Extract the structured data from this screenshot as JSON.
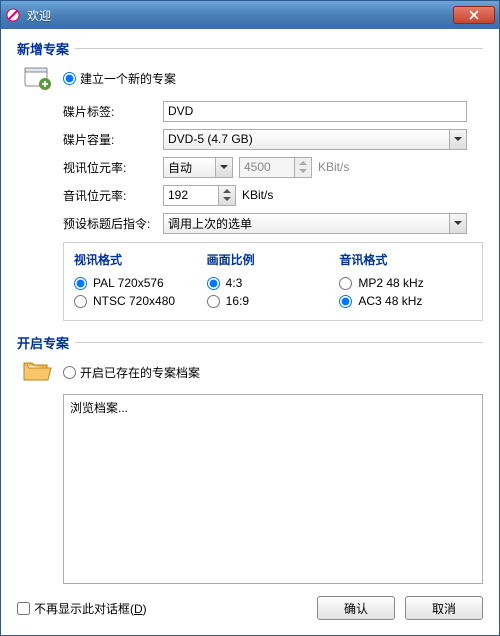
{
  "window": {
    "title": "欢迎"
  },
  "section_new": {
    "title": "新增专案",
    "create_option": "建立一个新的专案"
  },
  "form": {
    "disc_label_label": "碟片标签:",
    "disc_label_value": "DVD",
    "disc_capacity_label": "碟片容量:",
    "disc_capacity_value": "DVD-5 (4.7 GB)",
    "video_bitrate_label": "视讯位元率:",
    "video_bitrate_mode": "自动",
    "video_bitrate_value": "4500",
    "video_bitrate_unit": "KBit/s",
    "audio_bitrate_label": "音讯位元率:",
    "audio_bitrate_value": "192",
    "audio_bitrate_unit": "KBit/s",
    "post_cmd_label": "预设标题后指令:",
    "post_cmd_value": "调用上次的选单"
  },
  "fmt": {
    "video_title": "视讯格式",
    "video_pal": "PAL 720x576",
    "video_ntsc": "NTSC 720x480",
    "aspect_title": "画面比例",
    "aspect_43": "4:3",
    "aspect_169": "16:9",
    "audio_title": "音讯格式",
    "audio_mp2": "MP2 48 kHz",
    "audio_ac3": "AC3 48 kHz"
  },
  "section_open": {
    "title": "开启专案",
    "open_option": "开启已存在的专案档案",
    "browse_text": "浏览档案..."
  },
  "footer": {
    "dont_show_prefix": "不再显示此对话框(",
    "dont_show_key": "D",
    "dont_show_suffix": ")",
    "ok": "确认",
    "cancel": "取消"
  }
}
